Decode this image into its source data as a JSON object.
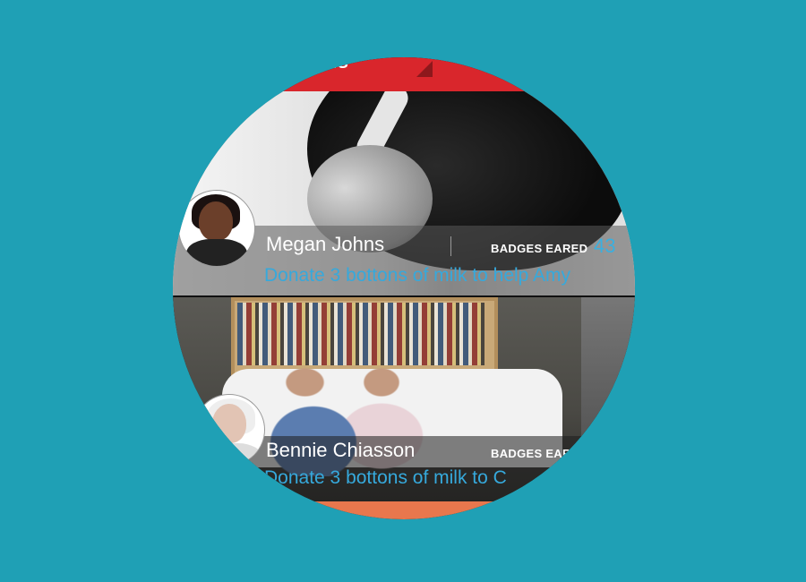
{
  "app": {
    "title": "...ds",
    "accent_color": "#d9262c",
    "background_color": "#1fa0b5"
  },
  "feed": [
    {
      "name": "Megan Johns",
      "badges_label": "BADGES EARED",
      "badges_count": "43",
      "message": "Donate 3 bottons of milk to help Amy",
      "avatar_icon": "avatar-woman-icon"
    },
    {
      "name": "Bennie Chiasson",
      "badges_label": "BADGES EAR",
      "badges_count": "",
      "message": "Donate 3 bottons of milk to C",
      "avatar_icon": "avatar-man-icon"
    }
  ]
}
